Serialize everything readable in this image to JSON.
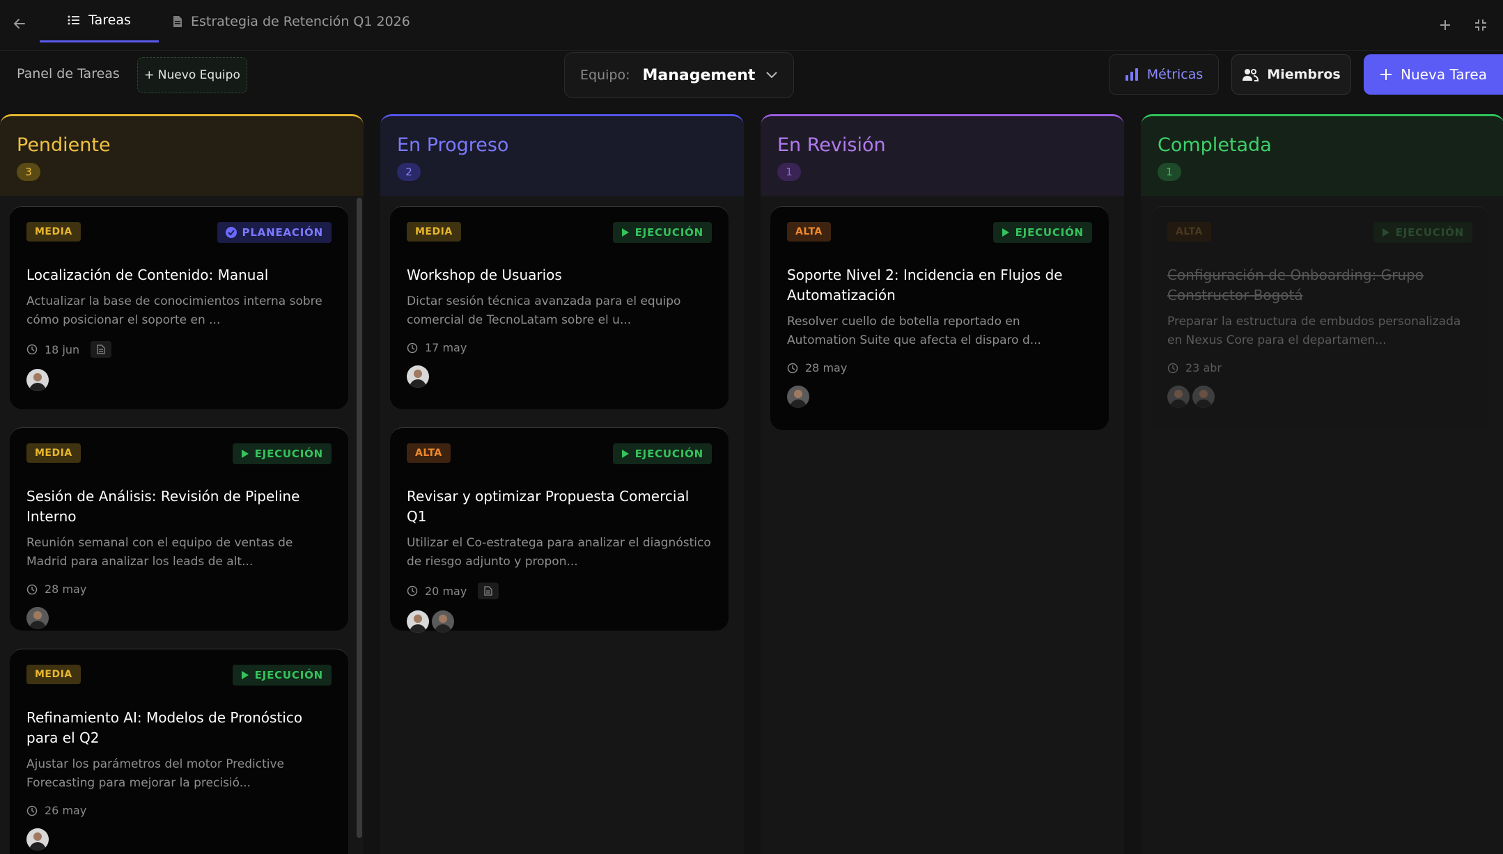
{
  "tabs": [
    {
      "label": "Tareas"
    },
    {
      "label": "Estrategia de Retención Q1 2026"
    }
  ],
  "toolbar": {
    "panel_title": "Panel de Tareas",
    "new_team": "+ Nuevo Equipo",
    "team_label": "Equipo:",
    "team_value": "Management",
    "metrics": "Métricas",
    "members": "Miembros",
    "new_task": "Nueva Tarea"
  },
  "colors": {
    "accent": "#5b5bf5",
    "pendiente": "#f0c040",
    "en_progreso": "#7a7aff",
    "en_revision": "#b07cf0",
    "completada": "#3fd06a"
  },
  "columns": [
    {
      "title": "Pendiente",
      "count": "3",
      "cards": [
        {
          "priority": "MEDIA",
          "status": "PLANEACIÓN",
          "status_icon": "check-circle-icon",
          "title": "Localización de Contenido: Manual",
          "desc": "Actualizar la base de conocimientos interna sobre cómo posicionar el soporte en ...",
          "date": "18 jun",
          "has_doc": true,
          "avatars": 1
        },
        {
          "priority": "MEDIA",
          "status": "EJECUCIÓN",
          "status_icon": "play-icon",
          "title": "Sesión de Análisis: Revisión de Pipeline Interno",
          "desc": "Reunión semanal con el equipo de ventas de Madrid para analizar los leads de alt...",
          "date": "28 may",
          "has_doc": false,
          "avatars": 1
        },
        {
          "priority": "MEDIA",
          "status": "EJECUCIÓN",
          "status_icon": "play-icon",
          "title": "Refinamiento AI: Modelos de Pronóstico para el Q2",
          "desc": "Ajustar los parámetros del motor Predictive Forecasting para mejorar la precisió...",
          "date": "26 may",
          "has_doc": false,
          "avatars": 1
        }
      ]
    },
    {
      "title": "En Progreso",
      "count": "2",
      "cards": [
        {
          "priority": "MEDIA",
          "status": "EJECUCIÓN",
          "status_icon": "play-icon",
          "title": "Workshop de Usuarios",
          "desc": "Dictar sesión técnica avanzada para el equipo comercial de TecnoLatam sobre el u...",
          "date": "17 may",
          "has_doc": false,
          "avatars": 1
        },
        {
          "priority": "ALTA",
          "status": "EJECUCIÓN",
          "status_icon": "play-icon",
          "title": "Revisar y optimizar Propuesta Comercial Q1",
          "desc": "Utilizar el Co-estratega para analizar el diagnóstico de riesgo adjunto y propon...",
          "date": "20 may",
          "has_doc": true,
          "avatars": 2
        }
      ]
    },
    {
      "title": "En Revisión",
      "count": "1",
      "cards": [
        {
          "priority": "ALTA",
          "status": "EJECUCIÓN",
          "status_icon": "play-icon",
          "title": "Soporte Nivel 2: Incidencia en Flujos de Automatización",
          "desc": "Resolver cuello de botella reportado en Automation Suite que afecta el disparo d...",
          "date": "28 may",
          "has_doc": false,
          "avatars": 1
        }
      ]
    },
    {
      "title": "Completada",
      "count": "1",
      "cards": [
        {
          "priority": "ALTA",
          "status": "EJECUCIÓN",
          "status_icon": "play-icon",
          "title": "Configuración de Onboarding: Grupo Constructor Bogotá",
          "desc": "Preparar la estructura de embudos personalizada en Nexus Core para el departamen...",
          "date": "23 abr",
          "has_doc": false,
          "avatars": 2
        }
      ]
    }
  ]
}
